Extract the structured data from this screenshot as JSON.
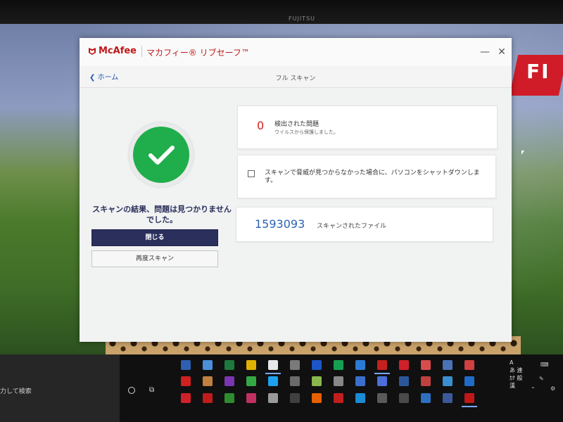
{
  "bezel": {
    "brand": "FUJITSU"
  },
  "wallpaper": {
    "banner_text": "FI"
  },
  "window": {
    "brand": "McAfee",
    "product": "マカフィー® リブセーフ™",
    "minimize_symbol": "—",
    "close_symbol": "✕"
  },
  "nav": {
    "back_label": "ホーム",
    "title": "フル スキャン"
  },
  "result": {
    "message": "スキャンの結果、問題は見つかりませんでした。",
    "close_button": "閉じる",
    "rescan_button": "再度スキャン"
  },
  "cards": {
    "issues": {
      "count": "0",
      "title": "検出された問題",
      "subtitle": "ウイルスから保護しました。"
    },
    "shutdown": {
      "checked": false,
      "text": "スキャンで脅威が見つからなかった場合に、パソコンをシャットダウンします。"
    },
    "files": {
      "count": "1593093",
      "label": "スキャンされたファイル"
    }
  },
  "taskbar": {
    "search_placeholder": "力して検索",
    "ime_lines": [
      "A",
      "あ 連",
      "ｶﾅ 般",
      "漢"
    ],
    "apps": [
      {
        "name": "app-blue-grid",
        "color": "#2f5fb0"
      },
      {
        "name": "app-network",
        "color": "#4a8fd8"
      },
      {
        "name": "app-excel",
        "color": "#1d7a3c"
      },
      {
        "name": "app-notes",
        "color": "#e0b000"
      },
      {
        "name": "app-chrome",
        "color": "#e8e8e8",
        "active": true
      },
      {
        "name": "app-disk",
        "color": "#7a7a7a"
      },
      {
        "name": "app-wave",
        "color": "#1d56c7"
      },
      {
        "name": "app-docomo",
        "color": "#159e52"
      },
      {
        "name": "app-edge-blue",
        "color": "#2b7bd6"
      },
      {
        "name": "app-red-window",
        "color": "#c42020",
        "active": true
      },
      {
        "name": "app-yahoo",
        "color": "#d0202a"
      },
      {
        "name": "app-pinwheel",
        "color": "#d84c4c"
      },
      {
        "name": "app-image",
        "color": "#4a72b5"
      },
      {
        "name": "app-plus",
        "color": "#d04040"
      },
      {
        "name": "app-youtube",
        "color": "#d02020"
      },
      {
        "name": "app-photo",
        "color": "#c08040"
      },
      {
        "name": "app-onenote",
        "color": "#7a36b0"
      },
      {
        "name": "app-evernote",
        "color": "#35a846"
      },
      {
        "name": "app-twitter",
        "color": "#1da1f2"
      },
      {
        "name": "app-mail99",
        "color": "#6a6a6a"
      },
      {
        "name": "app-android",
        "color": "#89b84c"
      },
      {
        "name": "app-calc",
        "color": "#888888"
      },
      {
        "name": "app-calendar",
        "color": "#3a6fcc"
      },
      {
        "name": "app-play",
        "color": "#4b6fd8"
      },
      {
        "name": "app-word",
        "color": "#2b579a"
      },
      {
        "name": "app-movie",
        "color": "#c04040"
      },
      {
        "name": "app-screen",
        "color": "#3a8fd0"
      },
      {
        "name": "app-outlook",
        "color": "#1f6cc7"
      },
      {
        "name": "app-yahoo2",
        "color": "#d0202a"
      },
      {
        "name": "app-rakuten",
        "color": "#c01c1c"
      },
      {
        "name": "app-xbox",
        "color": "#2e8b2e"
      },
      {
        "name": "app-kanji",
        "color": "#c03060"
      },
      {
        "name": "app-printer",
        "color": "#9a9a9a"
      },
      {
        "name": "app-camera",
        "color": "#404040"
      },
      {
        "name": "app-firefox",
        "color": "#e66000"
      },
      {
        "name": "app-acrobat",
        "color": "#c21e1e"
      },
      {
        "name": "app-ie",
        "color": "#1a8bd4"
      },
      {
        "name": "app-media",
        "color": "#5a5a5a"
      },
      {
        "name": "app-folder",
        "color": "#4a4a4a"
      },
      {
        "name": "app-browser",
        "color": "#2f6fbf"
      },
      {
        "name": "app-facebook",
        "color": "#3b5998"
      },
      {
        "name": "app-mcafee",
        "color": "#c01818",
        "active": true
      }
    ]
  }
}
